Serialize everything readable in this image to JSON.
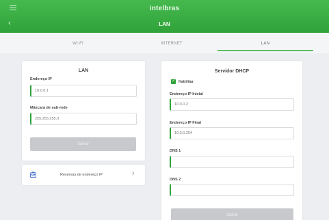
{
  "header": {
    "brand": "intelbras",
    "title": "LAN",
    "back_glyph": "‹",
    "menu_icon": "menu-icon",
    "background_color": "#2fa33a"
  },
  "tabs": [
    {
      "label": "WI-FI",
      "active": false
    },
    {
      "label": "INTERNET",
      "active": false
    },
    {
      "label": "LAN",
      "active": true
    }
  ],
  "lan": {
    "title": "LAN",
    "ip_label": "Endereço IP",
    "ip_value": "10.0.0.1",
    "mask_label": "Máscara de sub-rede",
    "mask_value": "255.255.255.0",
    "save_label": "Salvar"
  },
  "reservations": {
    "label": "Reservas de endereço IP",
    "icon": "network-icon",
    "chevron": "›"
  },
  "dhcp": {
    "title": "Servidor DHCP",
    "enable_label": "Habilitar",
    "enabled": true,
    "check_glyph": "✓",
    "start_label": "Endereço IP Inicial",
    "start_value": "10.0.0.2",
    "end_label": "Endereço IP Final",
    "end_value": "10.0.0.254",
    "dns1_label": "DNS 1",
    "dns1_value": "",
    "dns2_label": "DNS 2",
    "dns2_value": "",
    "save_label": "Salvar"
  },
  "colors": {
    "accent": "#2fa33a",
    "tab_underline": "#5fbf63",
    "button_disabled": "#c7c9cc"
  }
}
